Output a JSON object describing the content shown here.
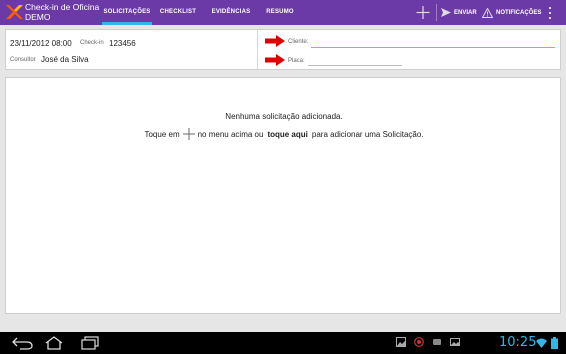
{
  "app": {
    "title": "Check-in de Oficina",
    "subtitle": "DEMO"
  },
  "tabs": [
    {
      "label": "SOLICITAÇÕES",
      "active": true
    },
    {
      "label": "CHECKLIST",
      "active": false
    },
    {
      "label": "EVIDÊNCIAS",
      "active": false
    },
    {
      "label": "RESUMO",
      "active": false
    }
  ],
  "actions": {
    "add_icon": "plus-icon",
    "send_label": "ENVIAR",
    "notifications_label": "NOTIFICAÇÕES",
    "overflow_icon": "overflow-menu-icon"
  },
  "header": {
    "date": "23/11/2012  08:00",
    "checkin_label": "Check-in",
    "checkin_value": "123456",
    "consultor_label": "Consultor",
    "consultor_value": "José da Silva",
    "cliente_label": "Cliente:",
    "cliente_value": "",
    "placa_label": "Placa:",
    "placa_value": ""
  },
  "empty_state": {
    "title": "Nenhuma solicitação adicionada.",
    "line_prefix": "Toque em",
    "line_middle": "no menu acima ou",
    "link": "toque aqui",
    "line_suffix": "para adicionar uma Solicitação."
  },
  "system_bar": {
    "time": "10:25"
  },
  "colors": {
    "actionbar": "#6b3aa6",
    "tab_indicator": "#33b5e5",
    "input_focus": "#f0a000",
    "arrow": "#e00000",
    "clock": "#33b5e5"
  }
}
